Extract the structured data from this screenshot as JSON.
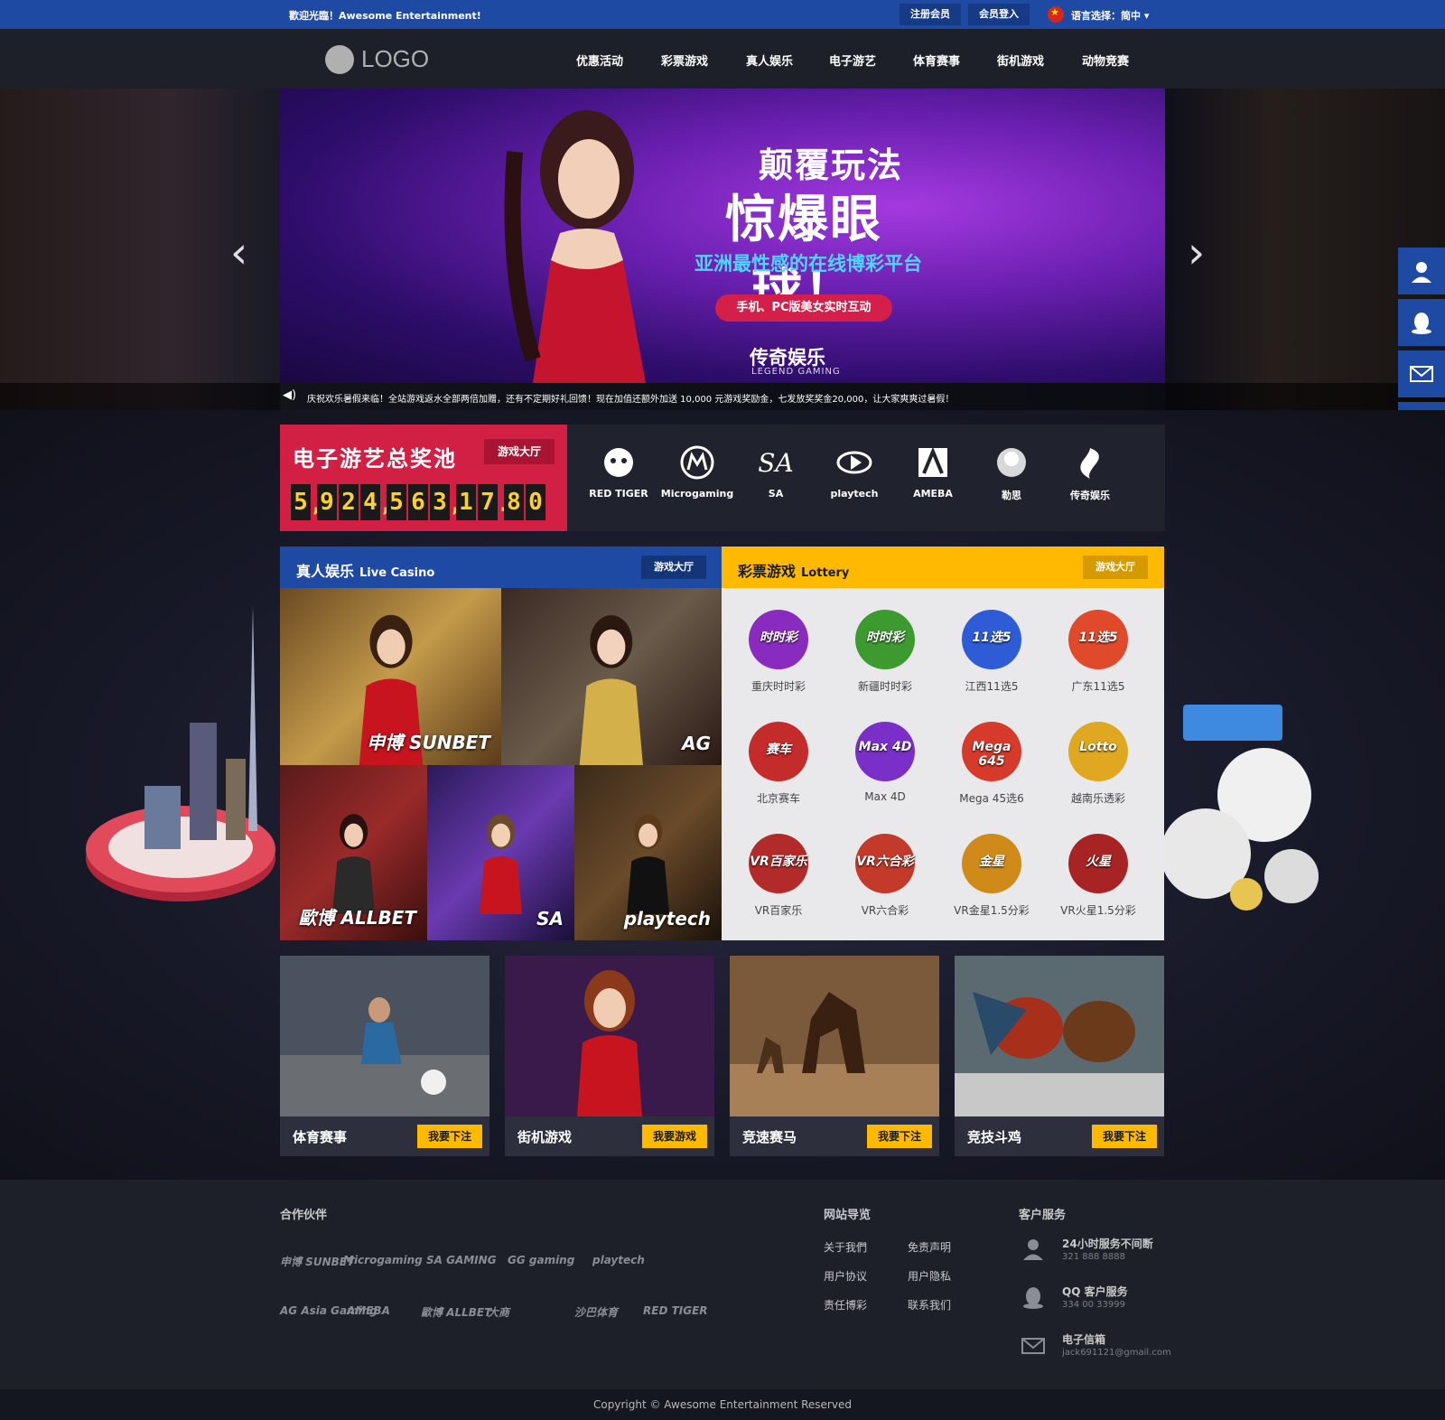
{
  "topbar": {
    "welcome": "歡迎光臨！Awesome Entertainment!",
    "register": "注册会员",
    "login": "会员登入",
    "language": "语言选择：简中"
  },
  "header": {
    "logo": "LOGO",
    "nav": [
      "优惠活动",
      "彩票游戏",
      "真人娱乐",
      "电子游艺",
      "体育赛事",
      "街机游戏",
      "动物竞赛"
    ]
  },
  "banner": {
    "line1": "颠覆玩法",
    "line2": "惊爆眼球！",
    "line3": "亚洲最性感的在线博彩平台",
    "pill": "手机、PC版美女实时互动",
    "brand": "传奇娱乐",
    "brand_sub": "LEGEND GAMING",
    "ticker": "庆祝欢乐暑假来临！全站游戏返水全部两倍加赠，还有不定期好礼回馈！现在加值还额外加送 10,000 元游戏奖励金，七发放奖奖金20,000，让大家爽爽过暑假！"
  },
  "jackpot": {
    "title": "电子游艺总奖池",
    "button": "游戏大厅",
    "digits": [
      "5",
      "9",
      "2",
      "4",
      "5",
      "6",
      "3",
      "1",
      "7",
      "8",
      "0"
    ],
    "separators_after": [
      0,
      3,
      6,
      8
    ]
  },
  "providers": [
    "RED TIGER",
    "Microgaming",
    "SA",
    "playtech",
    "AMEBA",
    "勒思",
    "传奇娱乐"
  ],
  "live": {
    "title": "真人娱乐",
    "subtitle": "Live Casino",
    "button": "游戏大厅",
    "tiles": [
      "申博 SUNBET",
      "AG",
      "歐博 ALLBET",
      "SA",
      "playtech"
    ]
  },
  "lottery": {
    "title": "彩票游戏",
    "subtitle": "Lottery",
    "button": "游戏大厅",
    "items": [
      {
        "name": "重庆时时彩",
        "icon": "时时彩",
        "color": "#8a2bbf"
      },
      {
        "name": "新疆时时彩",
        "icon": "时时彩",
        "color": "#3d9a2f"
      },
      {
        "name": "江西11选5",
        "icon": "11选5",
        "color": "#2d5cd6"
      },
      {
        "name": "广东11选5",
        "icon": "11选5",
        "color": "#e04a2a"
      },
      {
        "name": "北京赛车",
        "icon": "赛车",
        "color": "#c42b2b"
      },
      {
        "name": "Max 4D",
        "icon": "Max 4D",
        "color": "#7a2fc9"
      },
      {
        "name": "Mega 45选6",
        "icon": "Mega 645",
        "color": "#d63a2a"
      },
      {
        "name": "越南乐透彩",
        "icon": "Lotto",
        "color": "#e0a820"
      },
      {
        "name": "VR百家乐",
        "icon": "VR百家乐",
        "color": "#b32a2a"
      },
      {
        "name": "VR六合彩",
        "icon": "VR六合彩",
        "color": "#c43a2a"
      },
      {
        "name": "VR金星1.5分彩",
        "icon": "金星",
        "color": "#d08a1a"
      },
      {
        "name": "VR火星1.5分彩",
        "icon": "火星",
        "color": "#a82424"
      }
    ]
  },
  "cards": [
    {
      "name": "体育赛事",
      "button": "我要下注"
    },
    {
      "name": "街机游戏",
      "button": "我要游戏"
    },
    {
      "name": "竞速赛马",
      "button": "我要下注"
    },
    {
      "name": "竞技斗鸡",
      "button": "我要下注"
    }
  ],
  "footer": {
    "partners_title": "合作伙伴",
    "partners_row1": [
      "申博 SUNBET",
      "Microgaming",
      "SA GAMING",
      "GG gaming",
      "playtech"
    ],
    "partners_row2": [
      "AG Asia Gaming",
      "AMEBA",
      "歐博 ALLBET",
      "大商",
      "沙巴体育",
      "RED TIGER"
    ],
    "nav_title": "网站导览",
    "nav_links": [
      "关于我們",
      "免责声明",
      "用户协议",
      "用户隐私",
      "责任博彩",
      "联系我们"
    ],
    "service_title": "客户服务",
    "services": [
      {
        "title": "24小时服务不间断",
        "sub": "321 888 8888"
      },
      {
        "title": "QQ 客户服务",
        "sub": "334 00 33999"
      },
      {
        "title": "电子信箱",
        "sub": "jack691121@gmail.com"
      }
    ],
    "copyright": "Copyright © Awesome Entertainment Reserved"
  },
  "colors": {
    "topbar": "#1f4aa3",
    "live_head": "#1f4aa3",
    "lottery_head": "#ffba00",
    "jackpot": "#d21f44",
    "accent_button": "#ffba00"
  }
}
